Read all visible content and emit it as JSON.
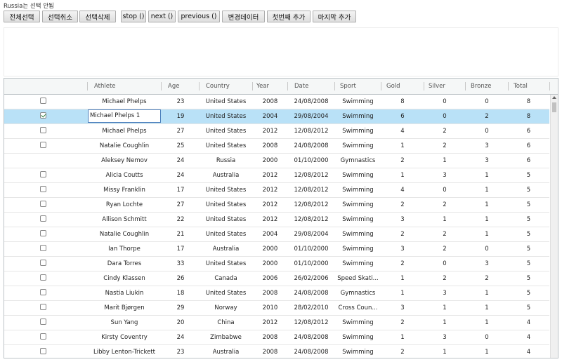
{
  "note": "Russia는 선택 안됨",
  "toolbar": {
    "select_all": "전체선택",
    "deselect": "선택취소",
    "delete_selected": "선택삭제",
    "stop": "stop ()",
    "next": "next ()",
    "previous": "previous ()",
    "changed_data": "변경데이터",
    "add_first": "첫번째 추가",
    "add_last": "마지막 추가"
  },
  "grid": {
    "columns": [
      "Athlete",
      "Age",
      "Country",
      "Year",
      "Date",
      "Sport",
      "Gold",
      "Silver",
      "Bronze",
      "Total"
    ],
    "editing_value": "Michael Phelps 1",
    "rows": [
      {
        "checkbox": true,
        "checked": false,
        "athlete": "Michael Phelps",
        "age": "23",
        "country": "United States",
        "year": "2008",
        "date": "24/08/2008",
        "sport": "Swimming",
        "gold": "8",
        "silver": "0",
        "bronze": "0",
        "total": "8"
      },
      {
        "checkbox": true,
        "checked": true,
        "selected": true,
        "editing": true,
        "athlete": "Michael Phelps 1",
        "age": "19",
        "country": "United States",
        "year": "2004",
        "date": "29/08/2004",
        "sport": "Swimming",
        "gold": "6",
        "silver": "0",
        "bronze": "2",
        "total": "8"
      },
      {
        "checkbox": true,
        "checked": false,
        "athlete": "Michael Phelps",
        "age": "27",
        "country": "United States",
        "year": "2012",
        "date": "12/08/2012",
        "sport": "Swimming",
        "gold": "4",
        "silver": "2",
        "bronze": "0",
        "total": "6"
      },
      {
        "checkbox": true,
        "checked": false,
        "athlete": "Natalie Coughlin",
        "age": "25",
        "country": "United States",
        "year": "2008",
        "date": "24/08/2008",
        "sport": "Swimming",
        "gold": "1",
        "silver": "2",
        "bronze": "3",
        "total": "6"
      },
      {
        "checkbox": false,
        "checked": false,
        "athlete": "Aleksey Nemov",
        "age": "24",
        "country": "Russia",
        "year": "2000",
        "date": "01/10/2000",
        "sport": "Gymnastics",
        "gold": "2",
        "silver": "1",
        "bronze": "3",
        "total": "6"
      },
      {
        "checkbox": true,
        "checked": false,
        "athlete": "Alicia Coutts",
        "age": "24",
        "country": "Australia",
        "year": "2012",
        "date": "12/08/2012",
        "sport": "Swimming",
        "gold": "1",
        "silver": "3",
        "bronze": "1",
        "total": "5"
      },
      {
        "checkbox": true,
        "checked": false,
        "athlete": "Missy Franklin",
        "age": "17",
        "country": "United States",
        "year": "2012",
        "date": "12/08/2012",
        "sport": "Swimming",
        "gold": "4",
        "silver": "0",
        "bronze": "1",
        "total": "5"
      },
      {
        "checkbox": true,
        "checked": false,
        "athlete": "Ryan Lochte",
        "age": "27",
        "country": "United States",
        "year": "2012",
        "date": "12/08/2012",
        "sport": "Swimming",
        "gold": "2",
        "silver": "2",
        "bronze": "1",
        "total": "5"
      },
      {
        "checkbox": true,
        "checked": false,
        "athlete": "Allison Schmitt",
        "age": "22",
        "country": "United States",
        "year": "2012",
        "date": "12/08/2012",
        "sport": "Swimming",
        "gold": "3",
        "silver": "1",
        "bronze": "1",
        "total": "5"
      },
      {
        "checkbox": true,
        "checked": false,
        "athlete": "Natalie Coughlin",
        "age": "21",
        "country": "United States",
        "year": "2004",
        "date": "29/08/2004",
        "sport": "Swimming",
        "gold": "2",
        "silver": "2",
        "bronze": "1",
        "total": "5"
      },
      {
        "checkbox": true,
        "checked": false,
        "athlete": "Ian Thorpe",
        "age": "17",
        "country": "Australia",
        "year": "2000",
        "date": "01/10/2000",
        "sport": "Swimming",
        "gold": "3",
        "silver": "2",
        "bronze": "0",
        "total": "5"
      },
      {
        "checkbox": true,
        "checked": false,
        "athlete": "Dara Torres",
        "age": "33",
        "country": "United States",
        "year": "2000",
        "date": "01/10/2000",
        "sport": "Swimming",
        "gold": "2",
        "silver": "0",
        "bronze": "3",
        "total": "5"
      },
      {
        "checkbox": true,
        "checked": false,
        "athlete": "Cindy Klassen",
        "age": "26",
        "country": "Canada",
        "year": "2006",
        "date": "26/02/2006",
        "sport": "Speed Skati...",
        "gold": "1",
        "silver": "2",
        "bronze": "2",
        "total": "5"
      },
      {
        "checkbox": true,
        "checked": false,
        "athlete": "Nastia Liukin",
        "age": "18",
        "country": "United States",
        "year": "2008",
        "date": "24/08/2008",
        "sport": "Gymnastics",
        "gold": "1",
        "silver": "3",
        "bronze": "1",
        "total": "5"
      },
      {
        "checkbox": true,
        "checked": false,
        "athlete": "Marit Bjørgen",
        "age": "29",
        "country": "Norway",
        "year": "2010",
        "date": "28/02/2010",
        "sport": "Cross Coun...",
        "gold": "3",
        "silver": "1",
        "bronze": "1",
        "total": "5"
      },
      {
        "checkbox": true,
        "checked": false,
        "athlete": "Sun Yang",
        "age": "20",
        "country": "China",
        "year": "2012",
        "date": "12/08/2012",
        "sport": "Swimming",
        "gold": "2",
        "silver": "1",
        "bronze": "1",
        "total": "4"
      },
      {
        "checkbox": true,
        "checked": false,
        "athlete": "Kirsty Coventry",
        "age": "24",
        "country": "Zimbabwe",
        "year": "2008",
        "date": "24/08/2008",
        "sport": "Swimming",
        "gold": "1",
        "silver": "3",
        "bronze": "0",
        "total": "4"
      },
      {
        "checkbox": true,
        "checked": false,
        "athlete": "Libby Lenton-Trickett",
        "age": "23",
        "country": "Australia",
        "year": "2008",
        "date": "24/08/2008",
        "sport": "Swimming",
        "gold": "2",
        "silver": "1",
        "bronze": "1",
        "total": "4"
      }
    ]
  }
}
